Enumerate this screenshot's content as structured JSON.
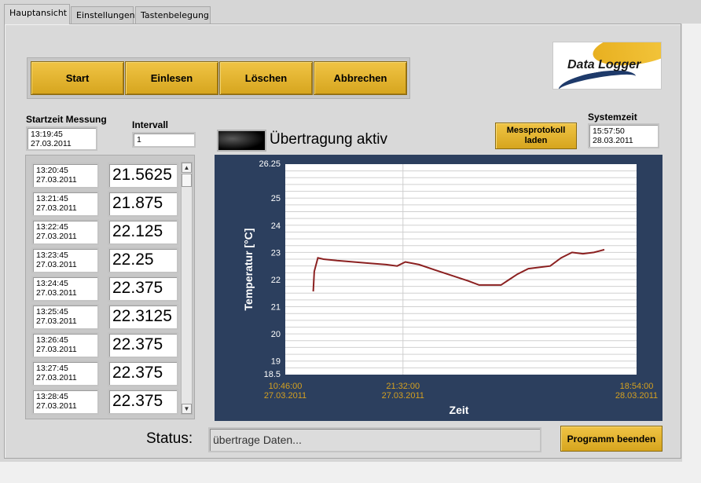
{
  "tabs": [
    {
      "label": "Hauptansicht",
      "active": true
    },
    {
      "label": "Einstellungen",
      "active": false
    },
    {
      "label": "Tastenbelegung",
      "active": false
    }
  ],
  "buttons": {
    "start": "Start",
    "einlesen": "Einlesen",
    "loeschen": "Löschen",
    "abbrechen": "Abbrechen"
  },
  "logo": {
    "text": "Data Logger"
  },
  "startzeit": {
    "label": "Startzeit Messung",
    "time": "13:19:45",
    "date": "27.03.2011"
  },
  "intervall": {
    "label": "Intervall",
    "value": "1"
  },
  "systemzeit": {
    "label": "Systemzeit",
    "time": "15:57:50",
    "date": "28.03.2011"
  },
  "led": {
    "label": "Übertragung aktiv"
  },
  "messprotokoll": {
    "line1": "Messprotokoll",
    "line2": "laden"
  },
  "measurements": [
    {
      "time": "13:20:45",
      "date": "27.03.2011",
      "value": "21.5625"
    },
    {
      "time": "13:21:45",
      "date": "27.03.2011",
      "value": "21.875"
    },
    {
      "time": "13:22:45",
      "date": "27.03.2011",
      "value": "22.125"
    },
    {
      "time": "13:23:45",
      "date": "27.03.2011",
      "value": "22.25"
    },
    {
      "time": "13:24:45",
      "date": "27.03.2011",
      "value": "22.375"
    },
    {
      "time": "13:25:45",
      "date": "27.03.2011",
      "value": "22.3125"
    },
    {
      "time": "13:26:45",
      "date": "27.03.2011",
      "value": "22.375"
    },
    {
      "time": "13:27:45",
      "date": "27.03.2011",
      "value": "22.375"
    },
    {
      "time": "13:28:45",
      "date": "27.03.2011",
      "value": "22.375"
    }
  ],
  "status": {
    "label": "Status:",
    "value": "übertrage Daten..."
  },
  "end_button": "Programm beenden",
  "colors": {
    "button": "#e4b42e",
    "chart_bg": "#2c3f5e",
    "trace": "#8b2020",
    "tick_label": "#d4a020"
  },
  "chart_data": {
    "type": "line",
    "xlabel": "Zeit",
    "ylabel": "Temperatur [°C]",
    "ylim": [
      18.5,
      26.25
    ],
    "y_ticks": [
      "26.25",
      "25",
      "24",
      "23",
      "22",
      "21",
      "20",
      "19",
      "18.5"
    ],
    "x_ticks": [
      {
        "time": "10:46:00",
        "date": "27.03.2011"
      },
      {
        "time": "21:32:00",
        "date": "27.03.2011"
      },
      {
        "time": "18:54:00",
        "date": "28.03.2011"
      }
    ],
    "series": [
      {
        "x": [
          "27.03.2011 13:19:45",
          "27.03.2011 13:25",
          "27.03.2011 13:45",
          "27.03.2011 14:15",
          "27.03.2011 15:30",
          "27.03.2011 17:00",
          "27.03.2011 18:30",
          "27.03.2011 20:00",
          "27.03.2011 21:00",
          "27.03.2011 21:45",
          "27.03.2011 23:00",
          "28.03.2011 00:30",
          "28.03.2011 02:00",
          "28.03.2011 03:30",
          "28.03.2011 04:30",
          "28.03.2011 05:30",
          "28.03.2011 06:30",
          "28.03.2011 07:15",
          "28.03.2011 08:00",
          "28.03.2011 09:00",
          "28.03.2011 10:00",
          "28.03.2011 11:00",
          "28.03.2011 12:00",
          "28.03.2011 13:00",
          "28.03.2011 14:00",
          "28.03.2011 15:00",
          "28.03.2011 15:57"
        ],
        "y": [
          21.5625,
          22.3,
          22.8,
          22.75,
          22.7,
          22.65,
          22.6,
          22.55,
          22.5,
          22.65,
          22.55,
          22.35,
          22.15,
          21.95,
          21.8,
          21.8,
          21.8,
          22.0,
          22.2,
          22.4,
          22.45,
          22.5,
          22.8,
          23.0,
          22.95,
          23.0,
          23.1
        ]
      }
    ]
  }
}
